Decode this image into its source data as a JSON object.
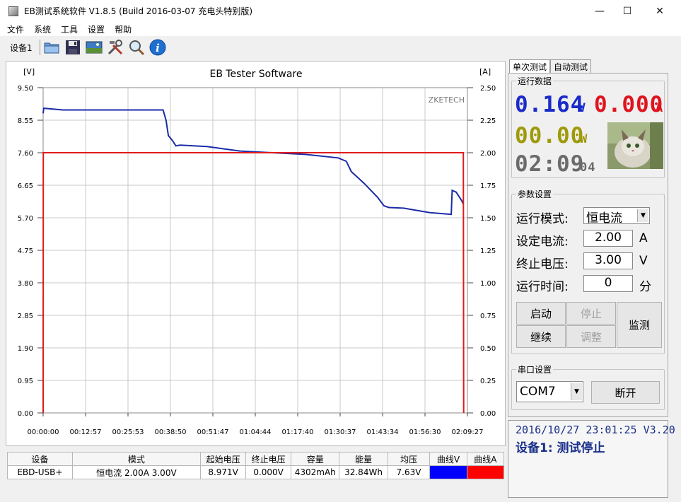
{
  "window": {
    "title": "EB测试系统软件 V1.8.5 (Build 2016-03-07 充电头特别版)",
    "min": "—",
    "max": "☐",
    "close": "✕"
  },
  "menu": [
    "文件",
    "系统",
    "工具",
    "设置",
    "帮助"
  ],
  "toolbar": {
    "device_label": "设备1",
    "icons": [
      "folder-icon",
      "save-icon",
      "image-icon",
      "tools-icon",
      "search-icon",
      "info-icon"
    ]
  },
  "chart_data": {
    "type": "line",
    "title": "EB Tester Software",
    "watermark": "ZKETECH",
    "ylabel_left": "[V]",
    "ylabel_right": "[A]",
    "y_left_ticks": [
      "9.50",
      "8.55",
      "7.60",
      "6.65",
      "5.70",
      "4.75",
      "3.80",
      "2.85",
      "1.90",
      "0.95",
      "0.00"
    ],
    "y_right_ticks": [
      "2.50",
      "2.25",
      "2.00",
      "1.75",
      "1.50",
      "1.25",
      "1.00",
      "0.75",
      "0.50",
      "0.25",
      "0.00"
    ],
    "x_ticks": [
      "00:00:00",
      "00:12:57",
      "00:25:53",
      "00:38:50",
      "00:51:47",
      "01:04:44",
      "01:17:40",
      "01:30:37",
      "01:43:34",
      "01:56:30",
      "02:09:27"
    ],
    "ylim_left": [
      0,
      9.5
    ],
    "ylim_right": [
      0,
      2.5
    ],
    "grid": true,
    "series": [
      {
        "axis": "left",
        "color": "#1c2ca8",
        "x_min": [
          0,
          0.2,
          6,
          36.6,
          37.5,
          38.2,
          39.5,
          40.5,
          41.8,
          50,
          60,
          70,
          80,
          90,
          92.5,
          94,
          98,
          100,
          102,
          104,
          105.5,
          110,
          118,
          124.5,
          124.8,
          126,
          127.7,
          128.2
        ],
        "values": [
          8.75,
          8.9,
          8.85,
          8.85,
          8.55,
          8.1,
          7.95,
          7.8,
          7.82,
          7.78,
          7.65,
          7.6,
          7.55,
          7.45,
          7.35,
          7.05,
          6.7,
          6.5,
          6.3,
          6.05,
          6.0,
          5.98,
          5.85,
          5.8,
          6.5,
          6.45,
          6.2,
          6.1
        ]
      },
      {
        "axis": "right",
        "color": "#e01b1b",
        "x_min": [
          0,
          0.05,
          128.2,
          128.3
        ],
        "values": [
          0,
          2.0,
          2.0,
          0
        ]
      }
    ]
  },
  "summary": {
    "headers": [
      "设备",
      "模式",
      "起始电压",
      "终止电压",
      "容量",
      "能量",
      "均压",
      "曲线V",
      "曲线A"
    ],
    "row": [
      "EBD-USB+",
      "恒电流  2.00A  3.00V",
      "8.971V",
      "0.000V",
      "4302mAh",
      "32.84Wh",
      "7.63V",
      "",
      ""
    ],
    "curve_v_color": "#0000ff",
    "curve_a_color": "#ff0000"
  },
  "tabs": [
    "单次测试",
    "自动测试"
  ],
  "run_data": {
    "title": "运行数据",
    "voltage": "0.164",
    "voltage_unit": "V",
    "current": "0.000",
    "current_unit": "A",
    "power": "00.00",
    "power_unit": "W",
    "time_main": "02:09",
    "time_sec": "04"
  },
  "params": {
    "title": "参数设置",
    "mode_label": "运行模式:",
    "mode_value": "恒电流",
    "current_label": "设定电流:",
    "current_value": "2.00",
    "current_unit": "A",
    "cutoff_label": "终止电压:",
    "cutoff_value": "3.00",
    "cutoff_unit": "V",
    "time_label": "运行时间:",
    "time_value": "0",
    "time_unit": "分"
  },
  "controls": {
    "start": "启动",
    "stop": "停止",
    "continue": "继续",
    "adjust": "调整",
    "monitor": "监测"
  },
  "serial": {
    "title": "串口设置",
    "port": "COM7",
    "disconnect": "断开"
  },
  "status": {
    "line1": "2016/10/27 23:01:25  V3.20",
    "line2": "设备1: 测试停止"
  }
}
